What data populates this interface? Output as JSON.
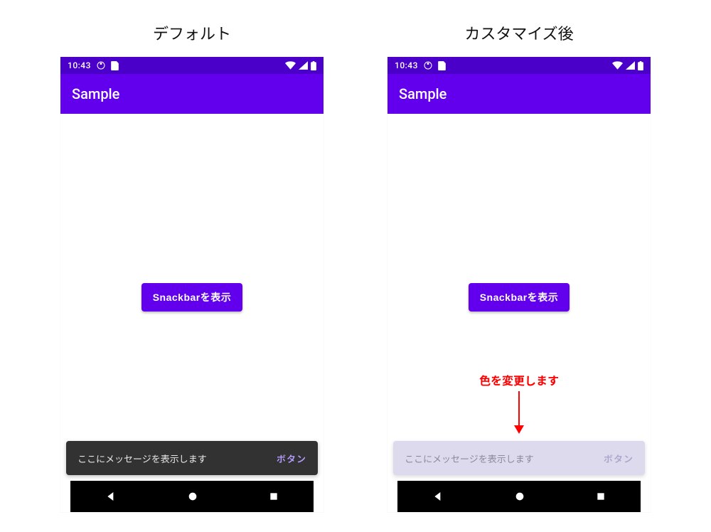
{
  "columns": {
    "left_title": "デフォルト",
    "right_title": "カスタマイズ後"
  },
  "statusbar": {
    "time": "10:43"
  },
  "appbar": {
    "title": "Sample"
  },
  "main": {
    "button_label": "Snackbarを表示"
  },
  "snackbar": {
    "message": "ここにメッセージを表示します",
    "action_label": "ボタン"
  },
  "annotation": {
    "text": "色を変更します"
  },
  "colors": {
    "primary": "#6200ee",
    "primary_dark": "#4a00c8",
    "snackbar_default_bg": "#323232",
    "snackbar_custom_bg": "#dddaee",
    "annotation": "#ff0000"
  }
}
